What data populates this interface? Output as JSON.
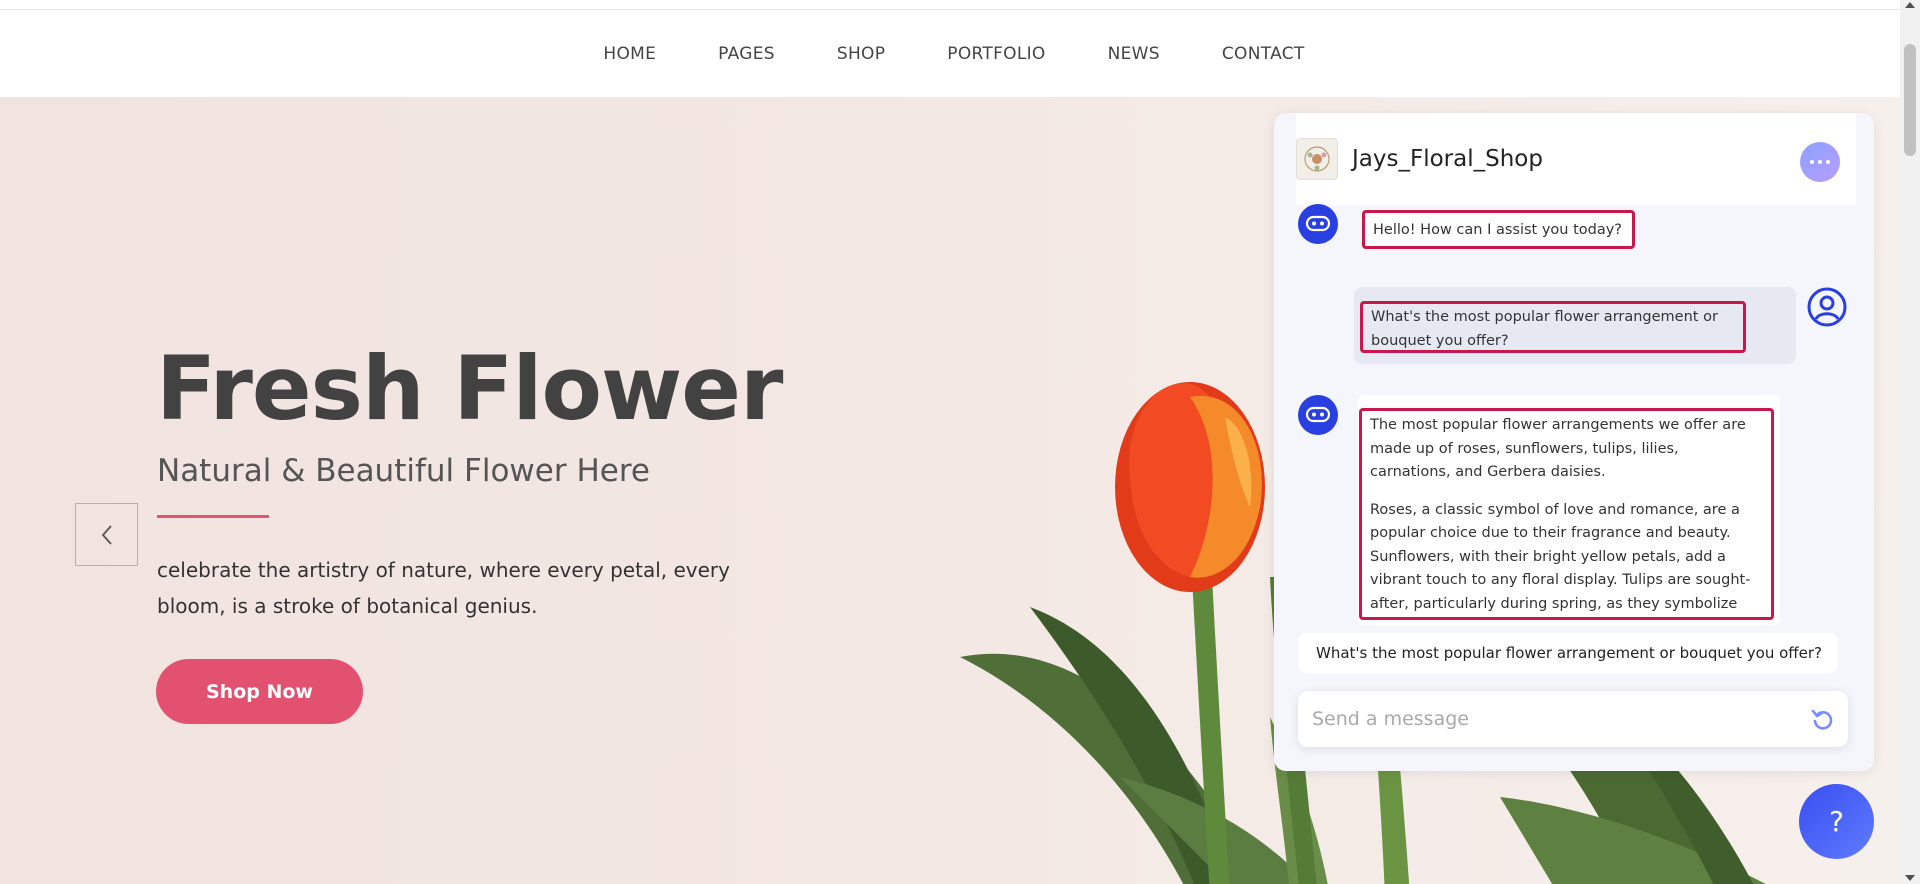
{
  "nav": {
    "items": [
      {
        "label": "HOME"
      },
      {
        "label": "PAGES"
      },
      {
        "label": "SHOP"
      },
      {
        "label": "PORTFOLIO"
      },
      {
        "label": "NEWS"
      },
      {
        "label": "CONTACT"
      }
    ]
  },
  "hero": {
    "title": "Fresh Flower",
    "subtitle": "Natural & Beautiful Flower Here",
    "description": "celebrate the artistry of nature, where every petal, every bloom, is a stroke of botanical genius.",
    "cta_label": "Shop Now",
    "accent_color": "#e25270"
  },
  "chat": {
    "title": "Jays_Floral_Shop",
    "messages": {
      "bot_greeting": "Hello! How can I assist you today?",
      "user_question": "What's the most popular flower arrangement or bouquet you offer?",
      "bot_answer_p1": "The most popular flower arrangements we offer are made up of roses, sunflowers, tulips, lilies, carnations, and Gerbera daisies.",
      "bot_answer_p2": "Roses, a classic symbol of love and romance, are a popular choice due to their fragrance and beauty. Sunflowers, with their bright yellow petals, add a vibrant touch to any floral display. Tulips are sought-after, particularly during spring, as they symbolize"
    },
    "suggestion": "What's the most popular flower arrangement or bouquet you offer?",
    "input_placeholder": "Send a message",
    "highlight_color": "#c8174a",
    "bot_color": "#2a3fe0"
  },
  "help_button": {
    "label": "?"
  },
  "icons": {
    "prev": "chevron-left-icon",
    "menu": "more-horizontal-icon",
    "refresh": "refresh-icon",
    "bot": "bot-icon",
    "user": "user-icon"
  }
}
